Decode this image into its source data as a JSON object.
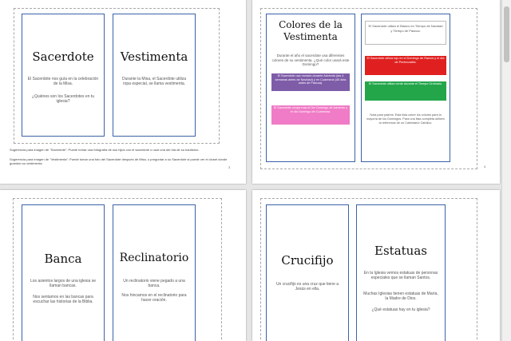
{
  "pages": {
    "p1": {
      "card_a": {
        "title": "Sacerdote",
        "text1": "El Sacerdote nos guía en la celebración de la Misa.",
        "text2": "¿Quiénes son los Sacerdotes en tu iglesia?"
      },
      "card_b": {
        "title": "Vestimenta",
        "text1": "Durante la Misa, el Sacerdote utiliza ropa especial, se llama vestimenta."
      },
      "note1": "Sugerencia para imagen de \"Sacerdote\": Puede tomar una fotografía de sus hijos con el sacerdote o usar una del día de su bautismo.",
      "note2": "Sugerencia para imagen de \"Vestimenta\": Puede tomar una foto del Sacerdote después de Misa, o preguntar a su Sacerdote si puede ver el closet donde guardan su vestimenta.",
      "page_number": "3"
    },
    "p2": {
      "card_a": {
        "title": "Colores de la Vestimenta",
        "intro": "Durante el año el sacerdote usa diferentes colores de su vestimenta. ¿Qué color usará este Domingo?",
        "purple": "El Sacerdote usa morado durante Adviento (las 4 semanas antes de Navidad) y en Cuaresma (40 días antes de Pascua).",
        "pink": "El Sacerdote ocupa rosa el 3er Domingo de Adviento y el 4to Domingo de Cuaresma."
      },
      "card_b": {
        "white": "El Sacerdote utiliza el Blanco en Tiempo de Navidad y Tiempo de Pascua.",
        "red": "El Sacerdote utiliza rojo en el Domingo de Ramos y el día de Pentecostés.",
        "green": "El Sacerdote utiliza verde durante el Tiempo Ordinario.",
        "note": "Nota para padres: Esta lista cubre los colores para la mayoría de los Domingos. Para una lista completa utilicen la referencia de un Calendario Católico."
      },
      "page_number": "4"
    },
    "p3": {
      "card_a": {
        "title": "Banca",
        "text1": "Los asientos largos de una iglesia se llaman bancas.",
        "text2": "Nos sentamos en las bancas para escuchar las historias de la Biblia."
      },
      "card_b": {
        "title": "Reclinatorio",
        "text1": "Un reclinatorio viene pegado a una banca.",
        "text2": "Nos hincamos en el reclinatorio para hacer oración."
      }
    },
    "p4": {
      "card_a": {
        "title": "Crucifijo",
        "text1": "Un crucifijo es una cruz que tiene a Jesús en ella."
      },
      "card_b": {
        "title": "Estatuas",
        "text1": "En la Iglesia vemos estatuas de personas especiales que se llaman Santos.",
        "text2": "Muchas Iglesias tienen estatuas de María, la Madre de Dios.",
        "text3": "¿Qué estatuas hay en tu iglesia?"
      }
    }
  },
  "colors": {
    "card_border": "#3b62a8",
    "purple": "#7e5ca8",
    "pink": "#f07bc6",
    "red": "#e02020",
    "green": "#23a64a"
  }
}
